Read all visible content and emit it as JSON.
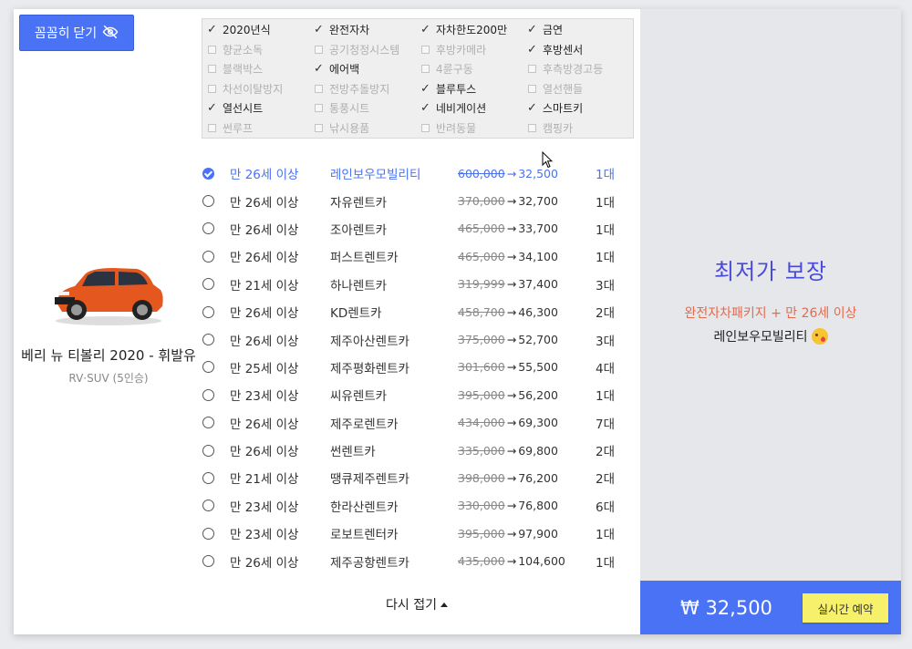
{
  "toggle_button": {
    "label": "꼼꼼히 닫기",
    "icon": "eye-off-icon"
  },
  "car": {
    "name": "베리 뉴 티볼리 2020 - 휘발유",
    "type": "RV·SUV (5인승)"
  },
  "options": [
    {
      "label": "2020년식",
      "checked": true
    },
    {
      "label": "완전자차",
      "checked": true
    },
    {
      "label": "자차한도200만",
      "checked": true
    },
    {
      "label": "금연",
      "checked": true
    },
    {
      "label": "향균소독",
      "checked": false
    },
    {
      "label": "공기청정시스템",
      "checked": false
    },
    {
      "label": "후방카메라",
      "checked": false
    },
    {
      "label": "후방센서",
      "checked": true
    },
    {
      "label": "블랙박스",
      "checked": false
    },
    {
      "label": "에어백",
      "checked": true
    },
    {
      "label": "4륜구동",
      "checked": false
    },
    {
      "label": "후측방경고등",
      "checked": false
    },
    {
      "label": "차선이탈방지",
      "checked": false
    },
    {
      "label": "전방추돌방지",
      "checked": false
    },
    {
      "label": "블루투스",
      "checked": true
    },
    {
      "label": "열선핸들",
      "checked": false
    },
    {
      "label": "열선시트",
      "checked": true
    },
    {
      "label": "통풍시트",
      "checked": false
    },
    {
      "label": "네비게이션",
      "checked": true
    },
    {
      "label": "스마트키",
      "checked": true
    },
    {
      "label": "썬루프",
      "checked": false
    },
    {
      "label": "낚시용품",
      "checked": false
    },
    {
      "label": "반려동물",
      "checked": false
    },
    {
      "label": "캠핑카",
      "checked": false
    }
  ],
  "rentals": [
    {
      "age": "만 26세 이상",
      "company": "레인보우모빌리티",
      "original": "600,000",
      "price": "32,500",
      "count": "1대",
      "selected": true
    },
    {
      "age": "만 26세 이상",
      "company": "자유렌트카",
      "original": "370,000",
      "price": "32,700",
      "count": "1대",
      "selected": false
    },
    {
      "age": "만 26세 이상",
      "company": "조아렌트카",
      "original": "465,000",
      "price": "33,700",
      "count": "1대",
      "selected": false
    },
    {
      "age": "만 26세 이상",
      "company": "퍼스트렌트카",
      "original": "465,000",
      "price": "34,100",
      "count": "1대",
      "selected": false
    },
    {
      "age": "만 21세 이상",
      "company": "하나렌트카",
      "original": "319,999",
      "price": "37,400",
      "count": "3대",
      "selected": false
    },
    {
      "age": "만 26세 이상",
      "company": "KD렌트카",
      "original": "458,700",
      "price": "46,300",
      "count": "2대",
      "selected": false
    },
    {
      "age": "만 26세 이상",
      "company": "제주아산렌트카",
      "original": "375,000",
      "price": "52,700",
      "count": "3대",
      "selected": false
    },
    {
      "age": "만 25세 이상",
      "company": "제주평화렌트카",
      "original": "301,600",
      "price": "55,500",
      "count": "4대",
      "selected": false
    },
    {
      "age": "만 23세 이상",
      "company": "씨유렌트카",
      "original": "395,000",
      "price": "56,200",
      "count": "1대",
      "selected": false
    },
    {
      "age": "만 26세 이상",
      "company": "제주로렌트카",
      "original": "434,000",
      "price": "69,300",
      "count": "7대",
      "selected": false
    },
    {
      "age": "만 26세 이상",
      "company": "썬렌트카",
      "original": "335,000",
      "price": "69,800",
      "count": "2대",
      "selected": false
    },
    {
      "age": "만 21세 이상",
      "company": "땡큐제주렌트카",
      "original": "398,000",
      "price": "76,200",
      "count": "2대",
      "selected": false
    },
    {
      "age": "만 23세 이상",
      "company": "한라산렌트카",
      "original": "330,000",
      "price": "76,800",
      "count": "6대",
      "selected": false
    },
    {
      "age": "만 23세 이상",
      "company": "로보트렌터카",
      "original": "395,000",
      "price": "97,900",
      "count": "1대",
      "selected": false
    },
    {
      "age": "만 26세 이상",
      "company": "제주공항렌트카",
      "original": "435,000",
      "price": "104,600",
      "count": "1대",
      "selected": false
    }
  ],
  "arrow_symbol": "→",
  "collapse_label": "다시 접기",
  "summary": {
    "headline": "최저가 보장",
    "package": "완전자차패키지 + 만 26세 이상",
    "rental_company": "레인보우모빌리티"
  },
  "footer": {
    "total": "₩ 32,500",
    "book_label": "실시간 예약"
  },
  "colors": {
    "accent": "#4a72f5",
    "highlight_text": "#e46b4e",
    "book_button": "#f7f06a"
  }
}
